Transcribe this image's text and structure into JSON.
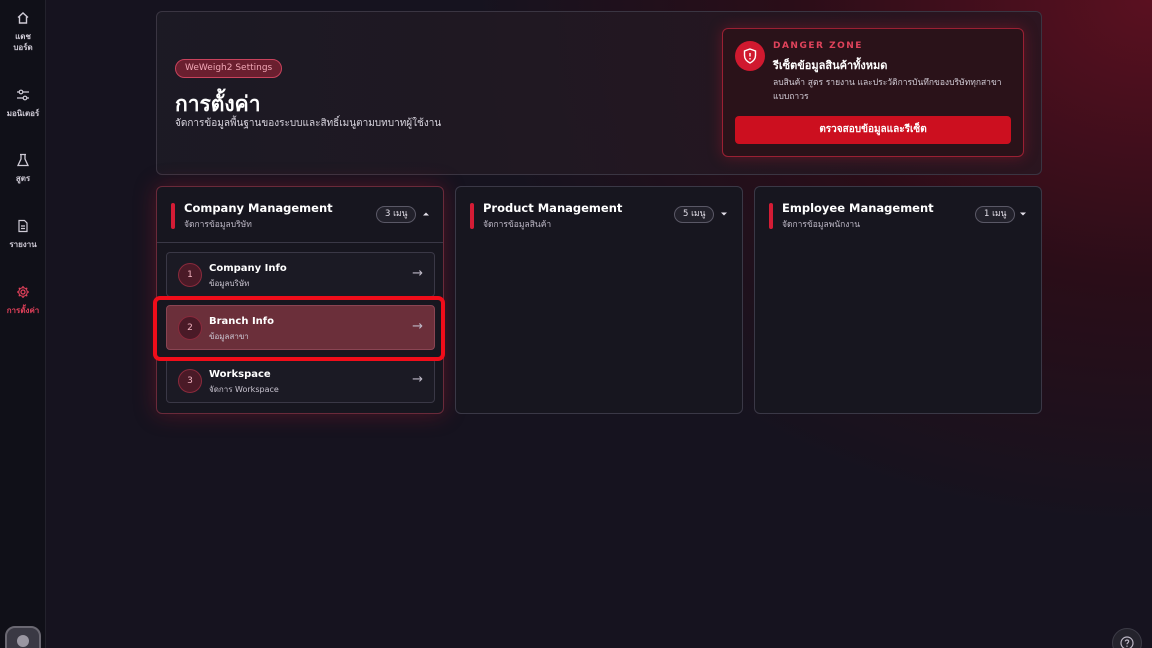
{
  "sidebar": {
    "items": [
      {
        "label_line1": "แดช",
        "label_line2": "บอร์ด",
        "icon": "home-icon"
      },
      {
        "label_line1": "มอนิเตอร์",
        "label_line2": "",
        "icon": "monitor-sliders-icon"
      },
      {
        "label_line1": "สูตร",
        "label_line2": "",
        "icon": "flask-icon"
      },
      {
        "label_line1": "รายงาน",
        "label_line2": "",
        "icon": "document-icon"
      },
      {
        "label_line1": "การตั้งค่า",
        "label_line2": "",
        "icon": "gear-icon",
        "active": true
      }
    ]
  },
  "header": {
    "pill": "WeWeigh2 Settings",
    "title": "การตั้งค่า",
    "subtitle": "จัดการข้อมูลพื้นฐานของระบบและสิทธิ์เมนูตามบทบาทผู้ใช้งาน"
  },
  "danger": {
    "kicker": "DANGER ZONE",
    "title": "รีเซ็ตข้อมูลสินค้าทั้งหมด",
    "description": "ลบสินค้า สูตร รายงาน และประวัติการบันทึกของบริษัททุกสาขาแบบถาวร",
    "button": "ตรวจสอบข้อมูลและรีเซ็ต"
  },
  "cards": [
    {
      "title": "Company Management",
      "subtitle": "จัดการข้อมูลบริษัท",
      "badge": "3 เมนู",
      "expanded": true,
      "items": [
        {
          "num": "1",
          "title": "Company Info",
          "subtitle": "ข้อมูลบริษัท",
          "arrow": "→"
        },
        {
          "num": "2",
          "title": "Branch Info",
          "subtitle": "ข้อมูลสาขา",
          "arrow": "→"
        },
        {
          "num": "3",
          "title": "Workspace",
          "subtitle": "จัดการ Workspace",
          "arrow": "→"
        }
      ]
    },
    {
      "title": "Product Management",
      "subtitle": "จัดการข้อมูลสินค้า",
      "badge": "5 เมนู",
      "expanded": false
    },
    {
      "title": "Employee Management",
      "subtitle": "จัดการข้อมูลพนักงาน",
      "badge": "1 เมนู",
      "expanded": false
    }
  ],
  "colors": {
    "accent": "#d41c35",
    "danger_button": "#cc0f1f",
    "highlight_ring": "#f00d1a"
  }
}
